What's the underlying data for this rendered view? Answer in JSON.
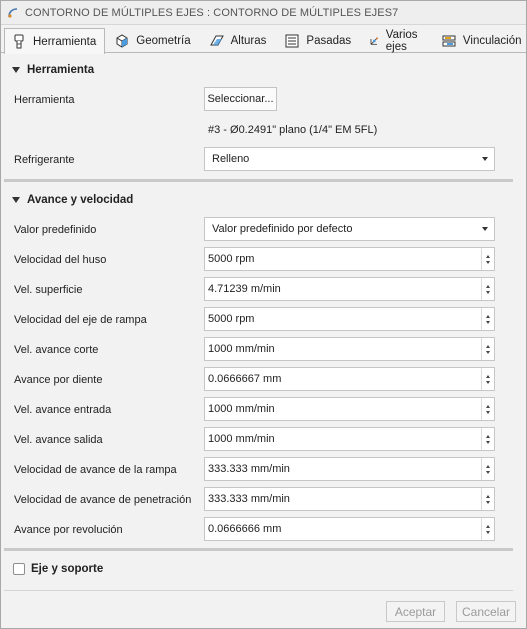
{
  "title": "CONTORNO DE MÚLTIPLES EJES : CONTORNO DE MÚLTIPLES EJES7",
  "tabs": [
    {
      "label": "Herramienta",
      "icon": "tool-icon",
      "active": true
    },
    {
      "label": "Geometría",
      "icon": "geometry-cube-icon",
      "active": false
    },
    {
      "label": "Alturas",
      "icon": "heights-icon",
      "active": false
    },
    {
      "label": "Pasadas",
      "icon": "passes-icon",
      "active": false
    },
    {
      "label": "Varios ejes",
      "icon": "multi-axis-icon",
      "active": false
    },
    {
      "label": "Vinculación",
      "icon": "linking-icon",
      "active": false
    }
  ],
  "tool_section": {
    "title": "Herramienta",
    "tool_label": "Herramienta",
    "select_button": "Seleccionar...",
    "tool_description": "#3 - Ø0.2491\" plano (1/4\" EM 5FL)",
    "coolant_label": "Refrigerante",
    "coolant_value": "Relleno"
  },
  "feed_section": {
    "title": "Avance y velocidad",
    "preset_label": "Valor predefinido",
    "preset_value": "Valor predefinido por defecto",
    "rows": [
      {
        "label": "Velocidad del huso",
        "value": "5000 rpm"
      },
      {
        "label": "Vel. superficie",
        "value": "4.71239 m/min"
      },
      {
        "label": "Velocidad del eje de rampa",
        "value": "5000 rpm"
      },
      {
        "label": "Vel. avance corte",
        "value": "1000 mm/min"
      },
      {
        "label": "Avance por diente",
        "value": "0.0666667 mm"
      },
      {
        "label": "Vel. avance entrada",
        "value": "1000 mm/min"
      },
      {
        "label": "Vel. avance salida",
        "value": "1000 mm/min"
      },
      {
        "label": "Velocidad de avance de la rampa",
        "value": "333.333 mm/min"
      },
      {
        "label": "Velocidad de avance de penetración",
        "value": "333.333 mm/min"
      },
      {
        "label": "Avance por revolución",
        "value": "0.0666666 mm"
      }
    ]
  },
  "shaft_section": {
    "label": "Eje y soporte",
    "checked": false
  },
  "footer": {
    "ok": "Aceptar",
    "cancel": "Cancelar"
  },
  "colors": {
    "background": "#f2f2f2",
    "field": "#ffffff",
    "divider": "#c9c9c9",
    "disabled_text": "#9b9b9b"
  }
}
